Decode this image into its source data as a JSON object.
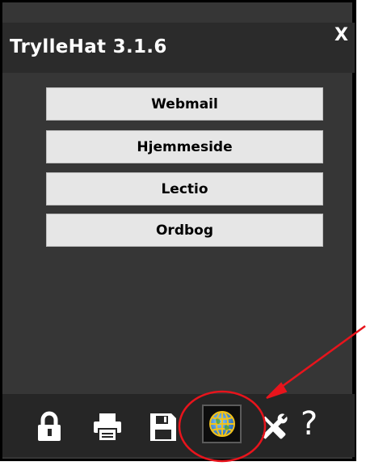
{
  "app": {
    "title": "TrylleHat 3.1.6",
    "close_label": "X"
  },
  "links": [
    {
      "label": "Webmail"
    },
    {
      "label": "Hjemmeside"
    },
    {
      "label": "Lectio"
    },
    {
      "label": "Ordbog"
    }
  ],
  "toolbar": {
    "icons": [
      "lock-icon",
      "printer-icon",
      "save-icon",
      "globe-icon",
      "tools-icon",
      "help-icon"
    ],
    "help_label": "?"
  },
  "annotation": {
    "color": "#e8141c"
  }
}
